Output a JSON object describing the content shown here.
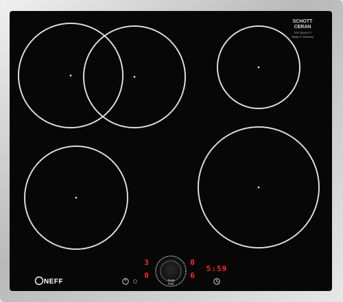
{
  "cooktop": {
    "brand_logo": "NEFF",
    "glass_brand": "SCHOTT CERAN",
    "glass_caption": [
      "TOP QUALITY",
      "Made in Germany"
    ],
    "displays": {
      "left_top": "3",
      "left_bottom": "0",
      "middle_top": "0",
      "middle_bottom": "6",
      "timer": "5:59"
    },
    "dial_label": [
      "Twist",
      "Pad"
    ],
    "icons": [
      "power-icon",
      "timer-icon",
      "dial-icon",
      "cooking-zone-icon"
    ]
  }
}
